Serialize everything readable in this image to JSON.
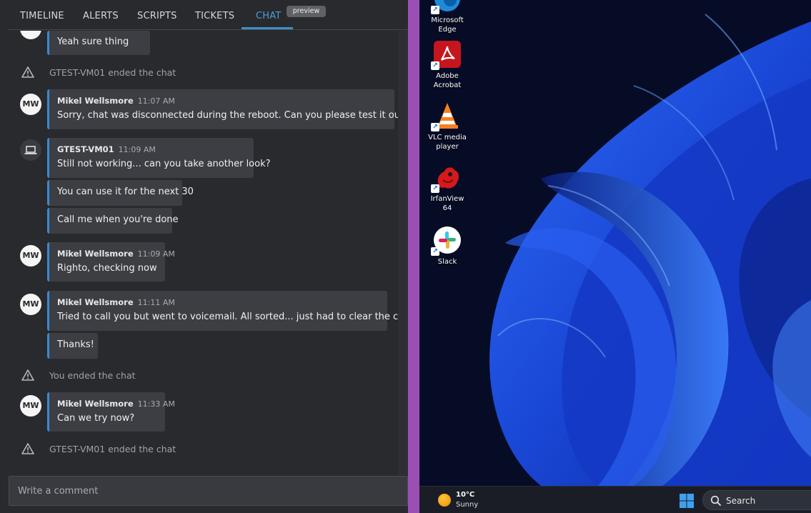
{
  "tabs": [
    {
      "label": "TIMELINE"
    },
    {
      "label": "ALERTS"
    },
    {
      "label": "SCRIPTS"
    },
    {
      "label": "TICKETS"
    },
    {
      "label": "CHAT",
      "badge": "preview",
      "active": true
    }
  ],
  "messages": {
    "cutoff_text": "Yeah sure thing",
    "sys1": "GTEST-VM01 ended the chat",
    "m1": {
      "initials": "MW",
      "sender": "Mikel Wellsmore",
      "time": "11:07 AM",
      "text": "Sorry, chat was disconnected during the reboot. Can you please test it out now?"
    },
    "m2": {
      "sender": "GTEST-VM01",
      "time": "11:09 AM",
      "text": "Still not working... can you take another look?"
    },
    "m2b": "You can use it for the next 30",
    "m2c": "Call me when you're done",
    "m3": {
      "initials": "MW",
      "sender": "Mikel Wellsmore",
      "time": "11:09 AM",
      "text": "Righto, checking now"
    },
    "m4": {
      "initials": "MW",
      "sender": "Mikel Wellsmore",
      "time": "11:11 AM",
      "text": "Tried to call you but went to voicemail. All sorted... just had to clear the cache."
    },
    "m4b": "Thanks!",
    "sys2": "You ended the chat",
    "m5": {
      "initials": "MW",
      "sender": "Mikel Wellsmore",
      "time": "11:33 AM",
      "text": "Can we try now?"
    },
    "sys3": "GTEST-VM01 ended the chat"
  },
  "comment": {
    "placeholder": "Write a comment"
  },
  "desktop": {
    "icons": [
      {
        "label_line1": "Microsoft",
        "label_line2": "Edge",
        "icon": "edge-icon"
      },
      {
        "label_line1": "Adobe",
        "label_line2": "Acrobat",
        "icon": "acrobat-icon"
      },
      {
        "label_line1": "VLC media",
        "label_line2": "player",
        "icon": "vlc-icon"
      },
      {
        "label_line1": "IrfanView 64",
        "label_line2": "",
        "icon": "irfanview-icon"
      },
      {
        "label_line1": "Slack",
        "label_line2": "",
        "icon": "slack-icon"
      }
    ],
    "taskbar": {
      "temperature": "10°C",
      "condition": "Sunny",
      "search_label": "Search"
    }
  },
  "colors": {
    "accent": "#3b8ad4",
    "divider": "#9b4fb5",
    "panel_bg": "#292a2d",
    "bubble_bg": "#3c3e44"
  }
}
